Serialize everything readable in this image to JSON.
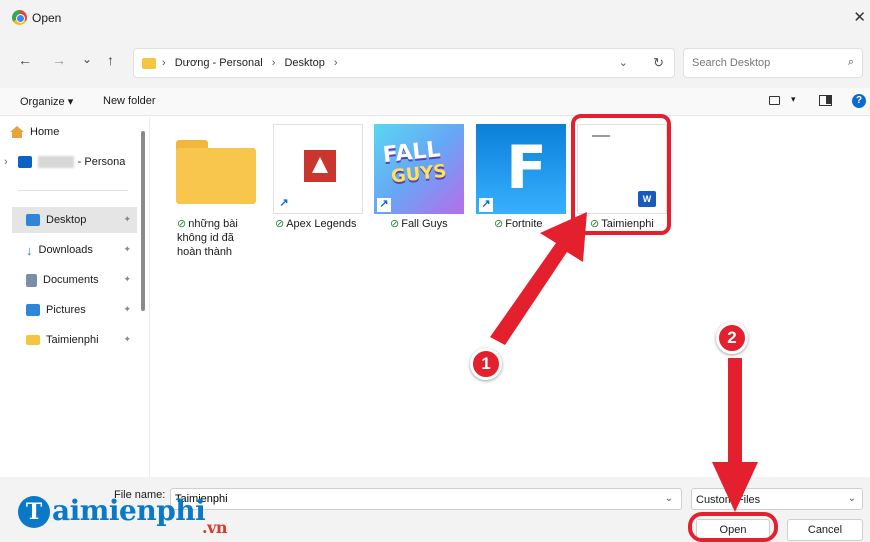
{
  "window": {
    "title": "Open",
    "close_glyph": "✕"
  },
  "nav": {
    "back": "←",
    "forward": "→",
    "recent": "⌄",
    "up": "↑",
    "breadcrumb": [
      "Dương - Personal",
      "Desktop"
    ],
    "separator": "›",
    "dropdown": "⌄",
    "refresh": "↻",
    "search_placeholder": "Search Desktop",
    "search_icon": "⌕"
  },
  "toolbar": {
    "organize": "Organize ▾",
    "new_folder": "New folder",
    "view_dd": "▾",
    "help": "?"
  },
  "sidebar": {
    "home": "Home",
    "onedrive_suffix": "- Persona",
    "expand": "›",
    "pin": "✦",
    "items": [
      "Desktop",
      "Downloads",
      "Documents",
      "Pictures",
      "Taimienphi"
    ],
    "downloads_glyph": "↓"
  },
  "files": [
    {
      "name": "những bài\nkhông id đã\nhoàn thành",
      "type": "folder"
    },
    {
      "name": "Apex Legends",
      "type": "shortcut"
    },
    {
      "name": "Fall Guys",
      "type": "shortcut"
    },
    {
      "name": "Fortnite",
      "type": "shortcut"
    },
    {
      "name": "Taimienphi",
      "type": "document"
    }
  ],
  "tiles": {
    "check": "⊘",
    "shortcut_arrow": "↗",
    "fall_line1": "FALL",
    "fall_line2": "GUYS",
    "fortnite_letter": "F",
    "word_letter": "W"
  },
  "bottom": {
    "file_name_label": "File name:",
    "file_name_value": "Taimienphi",
    "dropdown": "⌄",
    "file_type": "Custom Files",
    "open": "Open",
    "cancel": "Cancel"
  },
  "annotations": {
    "step1": "1",
    "step2": "2",
    "color": "#e5202e"
  },
  "logo": {
    "letter": "T",
    "word": "aimienphi",
    "tld": ".vn"
  },
  "colors": {
    "accent": "#0b6ad1",
    "highlight": "#e5202e",
    "folder": "#f8c64c"
  }
}
